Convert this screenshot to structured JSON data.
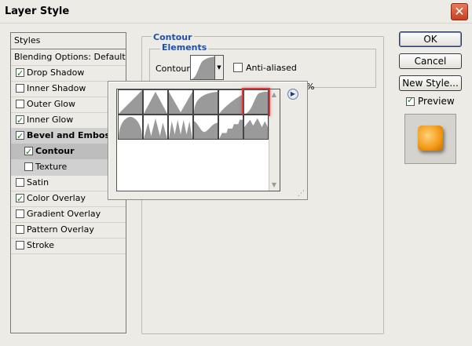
{
  "window": {
    "title": "Layer Style"
  },
  "styles_header": "Styles",
  "style_list": [
    {
      "label": "Blending Options: Default",
      "checkbox": false,
      "checked": false,
      "bold": false,
      "indent": false,
      "state": ""
    },
    {
      "label": "Drop Shadow",
      "checkbox": true,
      "checked": true,
      "bold": false,
      "indent": false,
      "state": ""
    },
    {
      "label": "Inner Shadow",
      "checkbox": true,
      "checked": false,
      "bold": false,
      "indent": false,
      "state": ""
    },
    {
      "label": "Outer Glow",
      "checkbox": true,
      "checked": false,
      "bold": false,
      "indent": false,
      "state": ""
    },
    {
      "label": "Inner Glow",
      "checkbox": true,
      "checked": true,
      "bold": false,
      "indent": false,
      "state": ""
    },
    {
      "label": "Bevel and Emboss",
      "checkbox": true,
      "checked": true,
      "bold": true,
      "indent": false,
      "state": "sub"
    },
    {
      "label": "Contour",
      "checkbox": true,
      "checked": true,
      "bold": true,
      "indent": true,
      "state": "sel"
    },
    {
      "label": "Texture",
      "checkbox": true,
      "checked": false,
      "bold": false,
      "indent": true,
      "state": "sub"
    },
    {
      "label": "Satin",
      "checkbox": true,
      "checked": false,
      "bold": false,
      "indent": false,
      "state": ""
    },
    {
      "label": "Color Overlay",
      "checkbox": true,
      "checked": true,
      "bold": false,
      "indent": false,
      "state": ""
    },
    {
      "label": "Gradient Overlay",
      "checkbox": true,
      "checked": false,
      "bold": false,
      "indent": false,
      "state": ""
    },
    {
      "label": "Pattern Overlay",
      "checkbox": true,
      "checked": false,
      "bold": false,
      "indent": false,
      "state": ""
    },
    {
      "label": "Stroke",
      "checkbox": true,
      "checked": false,
      "bold": false,
      "indent": false,
      "state": ""
    }
  ],
  "buttons": {
    "ok": "OK",
    "cancel": "Cancel",
    "new_style": "New Style..."
  },
  "preview": {
    "label": "Preview",
    "checked": true,
    "swatch_color": "#f39a16"
  },
  "contour_panel": {
    "group_title": "Contour",
    "elements_title": "Elements",
    "contour_label": "Contour:",
    "anti_aliased_label": "Anti-aliased",
    "anti_aliased_checked": false,
    "range_unit": "%"
  },
  "contour_picker": {
    "presets": [
      "linear",
      "cone",
      "cone-inverted",
      "cove-deep",
      "cove-shallow",
      "gaussian",
      "half-round",
      "ring",
      "ring-double",
      "rolling-slope",
      "rounded-steps",
      "sawtooth"
    ],
    "selected": "gaussian"
  },
  "colors": {
    "selection": "#d23b3b",
    "accent": "#1d50a8"
  }
}
